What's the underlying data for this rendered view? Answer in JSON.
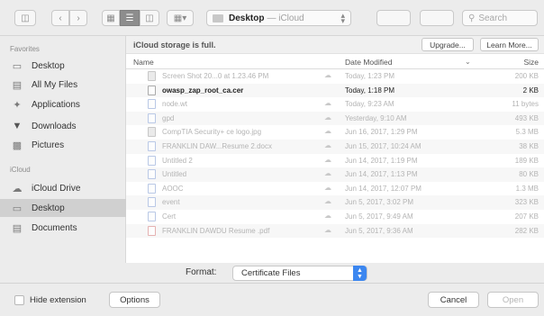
{
  "toolbar": {
    "sidebar_toggle_icon": "sidebar-icon",
    "back_icon": "chevron-left-icon",
    "forward_icon": "chevron-right-icon",
    "view_icons": [
      "icon-view-icon",
      "list-view-icon",
      "column-view-icon",
      "gallery-view-icon"
    ],
    "location": {
      "name": "Desktop",
      "service": "— iCloud"
    },
    "search_placeholder": "Search"
  },
  "sidebar": {
    "favorites_header": "Favorites",
    "favorites": [
      {
        "label": "Desktop",
        "icon": "desktop-icon"
      },
      {
        "label": "All My Files",
        "icon": "all-files-icon"
      },
      {
        "label": "Applications",
        "icon": "applications-icon"
      },
      {
        "label": "Downloads",
        "icon": "downloads-icon"
      },
      {
        "label": "Pictures",
        "icon": "pictures-icon"
      }
    ],
    "icloud_header": "iCloud",
    "icloud": [
      {
        "label": "iCloud Drive",
        "icon": "icloud-icon"
      },
      {
        "label": "Desktop",
        "icon": "desktop-icon",
        "selected": true
      },
      {
        "label": "Documents",
        "icon": "documents-icon"
      }
    ]
  },
  "notice": {
    "text": "iCloud storage is full.",
    "upgrade_label": "Upgrade...",
    "learn_more_label": "Learn More..."
  },
  "columns": {
    "name": "Name",
    "date": "Date Modified",
    "size": "Size"
  },
  "files": [
    {
      "name": "Screen Shot 20...0 at 1.23.46 PM",
      "date": "Today, 1:23 PM",
      "size": "200 KB",
      "enabled": false,
      "kind": "img"
    },
    {
      "name": "owasp_zap_root_ca.cer",
      "date": "Today, 1:18 PM",
      "size": "2 KB",
      "enabled": true,
      "kind": "cert"
    },
    {
      "name": "node.wt",
      "date": "Today, 9:23 AM",
      "size": "11 bytes",
      "enabled": false,
      "kind": "doc"
    },
    {
      "name": "gpd",
      "date": "Yesterday, 9:10 AM",
      "size": "493 KB",
      "enabled": false,
      "kind": "doc"
    },
    {
      "name": "CompTIA Security+ ce logo.jpg",
      "date": "Jun 16, 2017, 1:29 PM",
      "size": "5.3 MB",
      "enabled": false,
      "kind": "img"
    },
    {
      "name": "FRANKLIN DAW...Resume 2.docx",
      "date": "Jun 15, 2017, 10:24 AM",
      "size": "38 KB",
      "enabled": false,
      "kind": "doc"
    },
    {
      "name": "Untitled 2",
      "date": "Jun 14, 2017, 1:19 PM",
      "size": "189 KB",
      "enabled": false,
      "kind": "doc"
    },
    {
      "name": "Untitled",
      "date": "Jun 14, 2017, 1:13 PM",
      "size": "80 KB",
      "enabled": false,
      "kind": "doc"
    },
    {
      "name": "AOOC",
      "date": "Jun 14, 2017, 12:07 PM",
      "size": "1.3 MB",
      "enabled": false,
      "kind": "doc"
    },
    {
      "name": "event",
      "date": "Jun 5, 2017, 3:02 PM",
      "size": "323 KB",
      "enabled": false,
      "kind": "doc"
    },
    {
      "name": "Cert",
      "date": "Jun 5, 2017, 9:49 AM",
      "size": "207 KB",
      "enabled": false,
      "kind": "doc"
    },
    {
      "name": "FRANKLIN DAWDU Resume .pdf",
      "date": "Jun 5, 2017, 9:36 AM",
      "size": "282 KB",
      "enabled": false,
      "kind": "pdf"
    }
  ],
  "format": {
    "label": "Format:",
    "value": "Certificate Files"
  },
  "bottom": {
    "hide_extension_label": "Hide extension",
    "options_label": "Options",
    "cancel_label": "Cancel",
    "open_label": "Open"
  }
}
